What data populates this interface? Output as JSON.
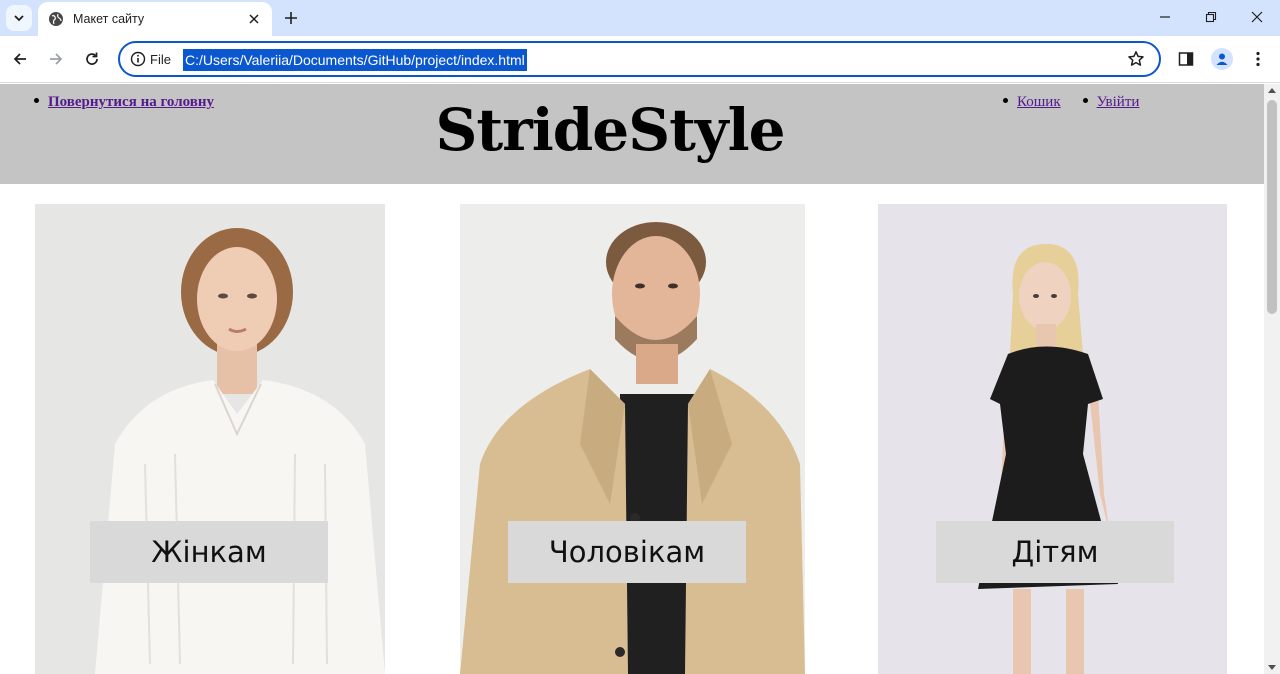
{
  "browser": {
    "tab_title": "Макет сайту",
    "scheme_label": "File",
    "url": "C:/Users/Valeriia/Documents/GitHub/project/index.html",
    "accent_color": "#0b57d0",
    "tabbar_color": "#d3e3fd"
  },
  "site": {
    "back_link": "Повернутися на головну",
    "brand": "StrideStyle",
    "nav": {
      "cart": "Кошик",
      "logout": "Увійти"
    },
    "header_color": "#c4c4c4",
    "categories": [
      {
        "label": "Жінкам",
        "icon": "woman-photo"
      },
      {
        "label": "Чоловікам",
        "icon": "man-photo"
      },
      {
        "label": "Дітям",
        "icon": "child-photo"
      }
    ]
  }
}
